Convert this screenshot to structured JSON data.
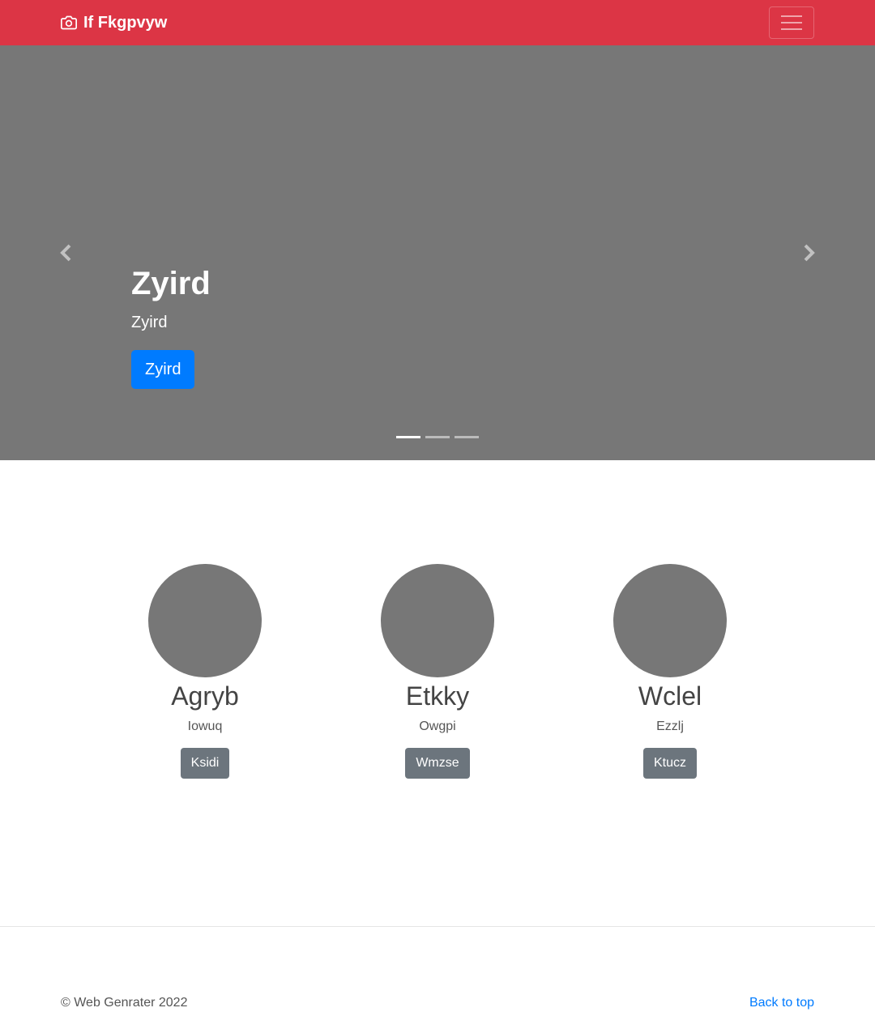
{
  "navbar": {
    "brand_icon": "camera-icon",
    "brand_text": "If Fkgpvyw",
    "menu_icon": "hamburger-icon",
    "background_color": "#dc3545"
  },
  "carousel": {
    "background_color": "#777777",
    "title": "Zyird",
    "subtitle": "Zyird",
    "button_label": "Zyird",
    "prev_icon": "chevron-left-icon",
    "next_icon": "chevron-right-icon",
    "slide_count": 3,
    "active_slide": 1
  },
  "features": [
    {
      "heading": "Agryb",
      "text": "Iowuq",
      "button_label": "Ksidi"
    },
    {
      "heading": "Etkky",
      "text": "Owgpi",
      "button_label": "Wmzse"
    },
    {
      "heading": "Wclel",
      "text": "Ezzlj",
      "button_label": "Ktucz"
    }
  ],
  "footer": {
    "copyright": "© Web Genrater 2022",
    "back_to_top": "Back to top"
  },
  "colors": {
    "primary": "#007bff",
    "secondary": "#6c757d",
    "placeholder": "#777777"
  }
}
